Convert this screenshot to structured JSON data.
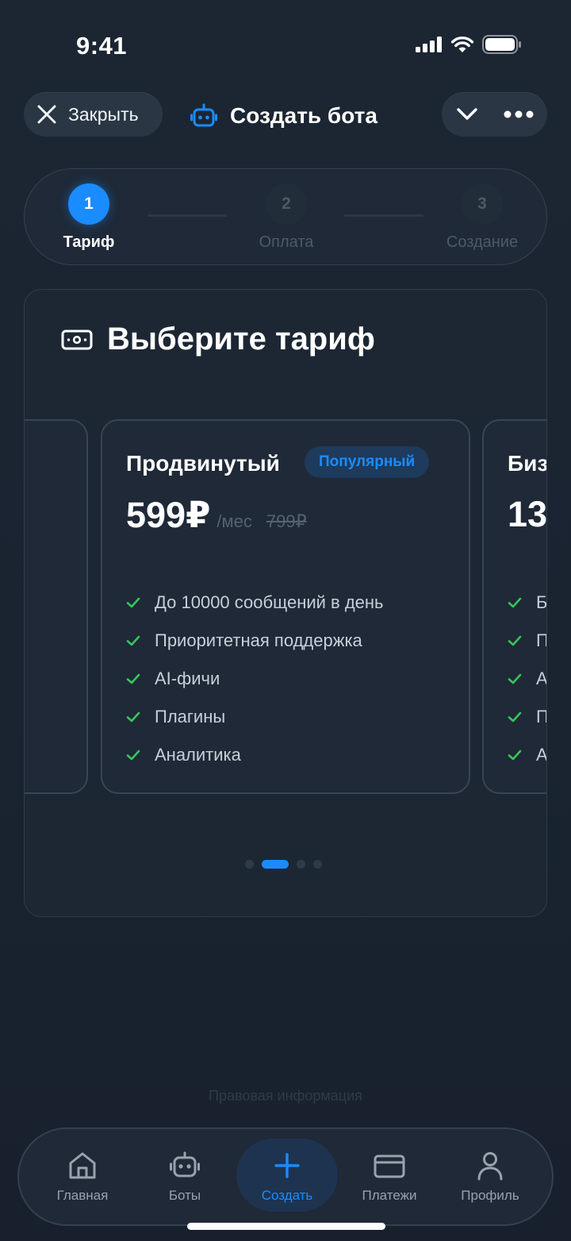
{
  "status_bar": {
    "time": "9:41",
    "icons": [
      "signal-icon",
      "wifi-icon",
      "battery-icon"
    ]
  },
  "header": {
    "close_label": "Закрыть",
    "title": "Создать бота",
    "icons": {
      "close": "close-icon",
      "bot": "robot-icon",
      "collapse": "chevron-down-icon",
      "more": "more-icon"
    }
  },
  "stepper": {
    "steps": [
      {
        "number": "1",
        "label": "Тариф",
        "active": true
      },
      {
        "number": "2",
        "label": "Оплата",
        "active": false
      },
      {
        "number": "3",
        "label": "Создание",
        "active": false
      }
    ]
  },
  "tariffs": {
    "title": "Выберите тариф",
    "title_icon": "banknote-icon",
    "current_plan": {
      "name": "Продвинутый",
      "badge": "Популярный",
      "price": "599₽",
      "period": "/мес",
      "old_price": "799₽",
      "features": [
        "До 10000 сообщений в день",
        "Приоритетная поддержка",
        "AI-фичи",
        "Плагины",
        "Аналитика"
      ]
    },
    "next_plan_peek": {
      "name_fragment": "Биз",
      "price_fragment": "13",
      "feature_initials": [
        "Б",
        "П",
        "А",
        "П",
        "А"
      ]
    },
    "pager": {
      "count": 4,
      "active_index": 1
    }
  },
  "footer": {
    "legal_link": "Правовая информация"
  },
  "tabbar": {
    "items": [
      {
        "label": "Главная",
        "icon": "home-icon",
        "active": false
      },
      {
        "label": "Боты",
        "icon": "robot-icon",
        "active": false
      },
      {
        "label": "Создать",
        "icon": "plus-icon",
        "active": true
      },
      {
        "label": "Платежи",
        "icon": "card-icon",
        "active": false
      },
      {
        "label": "Профиль",
        "icon": "user-icon",
        "active": false
      }
    ]
  },
  "colors": {
    "accent": "#1a8cff",
    "check": "#34c759",
    "background": "#1a2330"
  }
}
